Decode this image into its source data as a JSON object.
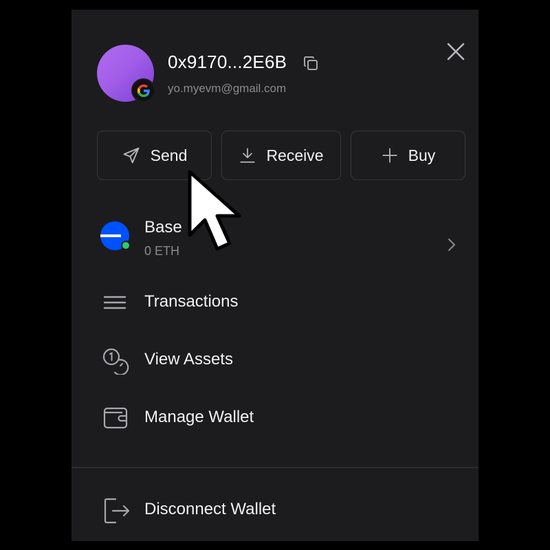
{
  "wallet": {
    "address": "0x9170...2E6B",
    "email": "yo.myevm@gmail.com"
  },
  "actions": {
    "send_label": "Send",
    "receive_label": "Receive",
    "buy_label": "Buy"
  },
  "network": {
    "name": "Base",
    "balance": "0 ETH",
    "status_color": "#2ecc71",
    "brand_color": "#0052ff"
  },
  "menu": {
    "transactions_label": "Transactions",
    "view_assets_label": "View Assets",
    "manage_wallet_label": "Manage Wallet",
    "disconnect_label": "Disconnect Wallet"
  },
  "icons": {
    "close": "close-icon",
    "copy": "copy-icon",
    "google": "google-icon",
    "send": "send-icon",
    "receive": "download-icon",
    "buy": "plus-icon",
    "transactions": "list-icon",
    "view_assets": "coins-icon",
    "manage_wallet": "wallet-icon",
    "disconnect": "logout-icon",
    "chevron": "chevron-right-icon"
  }
}
